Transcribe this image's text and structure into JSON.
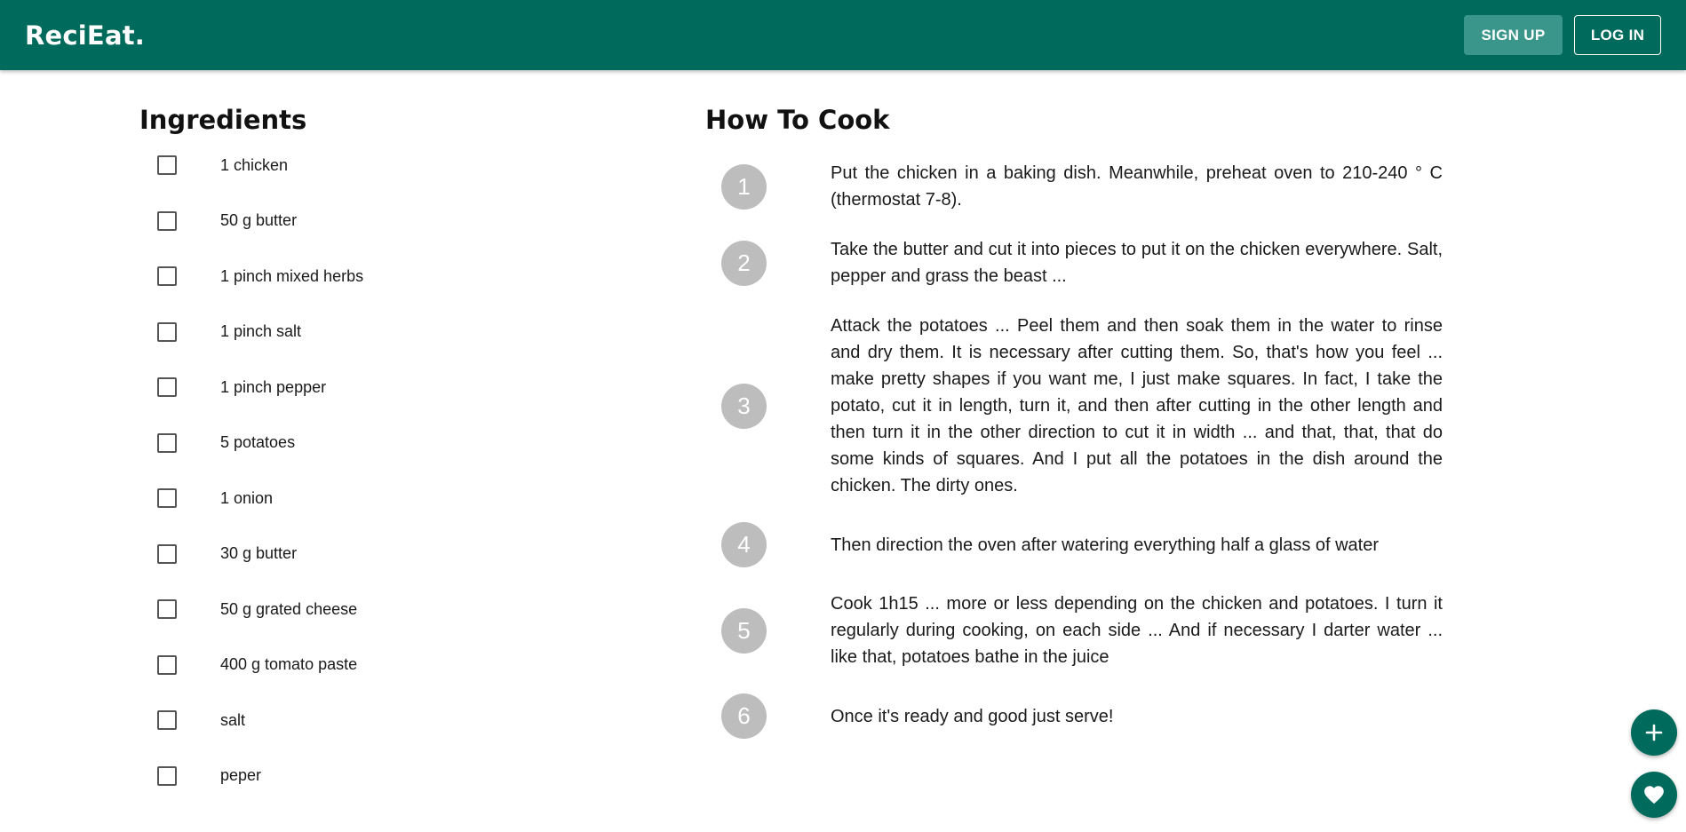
{
  "header": {
    "brand": "ReciEat.",
    "signup_label": "SIGN UP",
    "login_label": "LOG IN"
  },
  "ingredients": {
    "title": "Ingredients",
    "items": [
      {
        "label": "1 chicken",
        "checked": false
      },
      {
        "label": "50 g butter",
        "checked": false
      },
      {
        "label": "1 pinch mixed herbs",
        "checked": false
      },
      {
        "label": "1 pinch salt",
        "checked": false
      },
      {
        "label": "1 pinch pepper",
        "checked": false
      },
      {
        "label": "5 potatoes",
        "checked": false
      },
      {
        "label": "1 onion",
        "checked": false
      },
      {
        "label": "30 g butter",
        "checked": false
      },
      {
        "label": "50 g grated cheese",
        "checked": false
      },
      {
        "label": "400 g tomato paste",
        "checked": false
      },
      {
        "label": "salt",
        "checked": false
      },
      {
        "label": "peper",
        "checked": false
      }
    ]
  },
  "how_to_cook": {
    "title": "How To Cook",
    "steps": [
      {
        "number": "1",
        "text": "Put the chicken in a baking dish. Meanwhile, preheat oven to 210-240 ° C (thermostat 7-8)."
      },
      {
        "number": "2",
        "text": "Take the butter and cut it into pieces to put it on the chicken everywhere. Salt, pepper and grass the beast ..."
      },
      {
        "number": "3",
        "text": "Attack the potatoes ... Peel them and then soak them in the water to rinse and dry them. It is necessary after cutting them. So, that's how you feel ... make pretty shapes if you want me, I just make squares. In fact, I take the potato, cut it in length, turn it, and then after cutting in the other length and then turn it in the other direction to cut it in width ... and that, that, that do some kinds of squares. And I put all the potatoes in the dish around the chicken. The dirty ones."
      },
      {
        "number": "4",
        "text": "Then direction the oven after watering everything half a glass of water"
      },
      {
        "number": "5",
        "text": "Cook 1h15 ... more or less depending on the chicken and potatoes. I turn it regularly during cooking, on each side ... And if necessary I darter water ... like that, potatoes bathe in the juice"
      },
      {
        "number": "6",
        "text": "Once it's ready and good just serve!"
      }
    ]
  },
  "fabs": {
    "add_icon": "plus-icon",
    "favorite_icon": "heart-icon"
  },
  "colors": {
    "primary": "#006b5d",
    "signup_bg": "#3a968b",
    "step_circle": "#bdbdbd"
  }
}
